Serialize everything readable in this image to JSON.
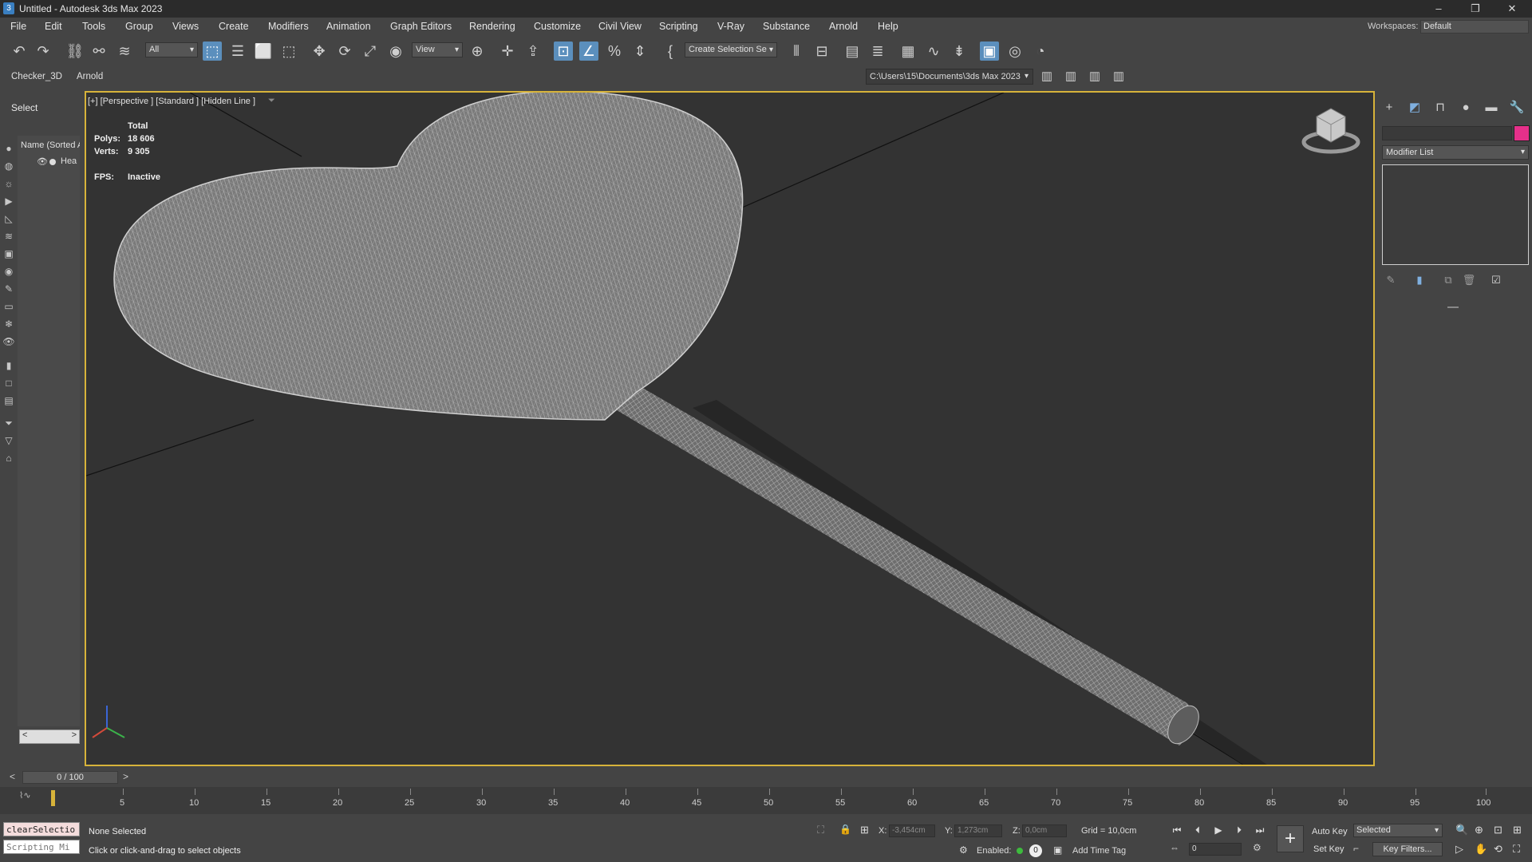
{
  "window": {
    "title": "Untitled - Autodesk 3ds Max 2023",
    "app_icon": "3"
  },
  "menu": [
    "File",
    "Edit",
    "Tools",
    "Group",
    "Views",
    "Create",
    "Modifiers",
    "Animation",
    "Graph Editors",
    "Rendering",
    "Customize",
    "Civil View",
    "Scripting",
    "V-Ray",
    "Substance",
    "Arnold",
    "Help"
  ],
  "workspaces": {
    "label": "Workspaces:",
    "value": "Default"
  },
  "toolbar": {
    "filter": "All",
    "ref_coord": "View",
    "selection_set": "Create Selection Se"
  },
  "ribbon": {
    "tabs": [
      "Checker_3D",
      "Arnold"
    ],
    "project_path": "C:\\Users\\15\\Documents\\3ds Max 2023"
  },
  "scene_explorer": {
    "select_label": "Select",
    "header": "Name (Sorted A",
    "item": "Hea"
  },
  "viewport": {
    "label": "[+] [Perspective ] [Standard ] [Hidden Line ]",
    "stats": {
      "total_label": "Total",
      "polys_label": "Polys:",
      "polys": "18 606",
      "verts_label": "Verts:",
      "verts": "9 305",
      "fps_label": "FPS:",
      "fps": "Inactive"
    }
  },
  "command_panel": {
    "modifier_list": "Modifier List",
    "object_color": "#e6308a"
  },
  "timeline": {
    "slider": "0 / 100",
    "ticks": [
      "5",
      "10",
      "15",
      "20",
      "25",
      "30",
      "35",
      "40",
      "45",
      "50",
      "55",
      "60",
      "65",
      "70",
      "75",
      "80",
      "85",
      "90",
      "95",
      "100"
    ]
  },
  "status": {
    "maxscript_line1": "clearSelectio",
    "maxscript_line2": "Scripting Mi",
    "selection": "None Selected",
    "prompt": "Click or click-and-drag to select objects",
    "x_label": "X:",
    "x": "-3,454cm",
    "y_label": "Y:",
    "y": "1,273cm",
    "z_label": "Z:",
    "z": "0,0cm",
    "grid": "Grid = 10,0cm",
    "enabled_label": "Enabled:",
    "add_time_tag": "Add Time Tag",
    "auto_key": "Auto Key",
    "selected": "Selected",
    "set_key": "Set Key",
    "key_filters": "Key Filters...",
    "frame": "0"
  },
  "colors": {
    "viewport_border": "#d7b33a",
    "active_tool": "#5b8fbd"
  }
}
